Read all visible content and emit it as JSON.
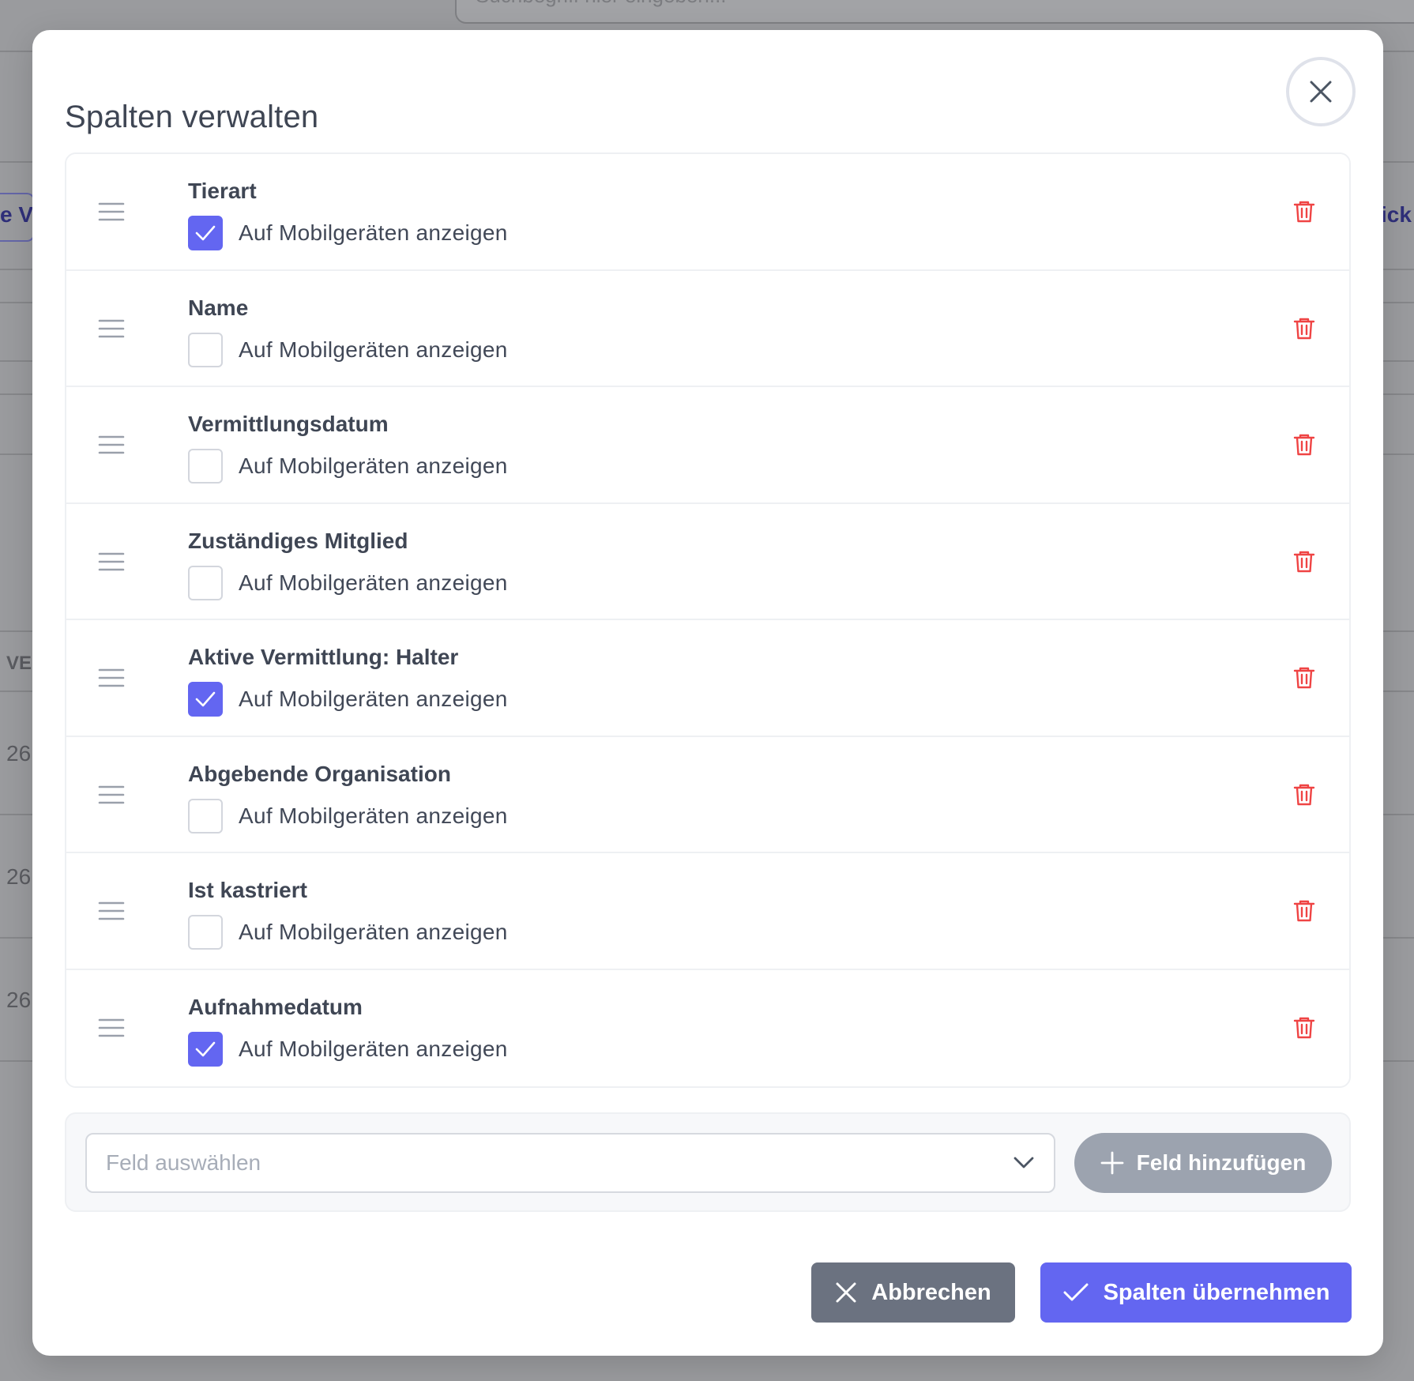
{
  "background": {
    "search_placeholder": "Suchbegriff hier eingeben...",
    "left_link_fragment": "e Ve",
    "right_link_fragment": "ick",
    "column_fragment": "VE",
    "row_values": [
      "26",
      "26",
      "26"
    ]
  },
  "modal": {
    "title": "Spalten verwalten",
    "close_label": "Schließen"
  },
  "columns": [
    {
      "name": "Tierart",
      "mobile_label": "Auf Mobilgeräten anzeigen",
      "show_on_mobile": true
    },
    {
      "name": "Name",
      "mobile_label": "Auf Mobilgeräten anzeigen",
      "show_on_mobile": false
    },
    {
      "name": "Vermittlungsdatum",
      "mobile_label": "Auf Mobilgeräten anzeigen",
      "show_on_mobile": false
    },
    {
      "name": "Zuständiges Mitglied",
      "mobile_label": "Auf Mobilgeräten anzeigen",
      "show_on_mobile": false
    },
    {
      "name": "Aktive Vermittlung: Halter",
      "mobile_label": "Auf Mobilgeräten anzeigen",
      "show_on_mobile": true
    },
    {
      "name": "Abgebende Organisation",
      "mobile_label": "Auf Mobilgeräten anzeigen",
      "show_on_mobile": false
    },
    {
      "name": "Ist kastriert",
      "mobile_label": "Auf Mobilgeräten anzeigen",
      "show_on_mobile": false
    },
    {
      "name": "Aufnahmedatum",
      "mobile_label": "Auf Mobilgeräten anzeigen",
      "show_on_mobile": true
    }
  ],
  "add_field": {
    "select_placeholder": "Feld auswählen",
    "button_label": "Feld hinzufügen"
  },
  "footer": {
    "cancel_label": "Abbrechen",
    "apply_label": "Spalten übernehmen"
  },
  "colors": {
    "accent": "#6366f1",
    "delete": "#ef4444",
    "secondary_button": "#6b7280",
    "disabled_button": "#9ca3af",
    "text": "#3f4654"
  }
}
